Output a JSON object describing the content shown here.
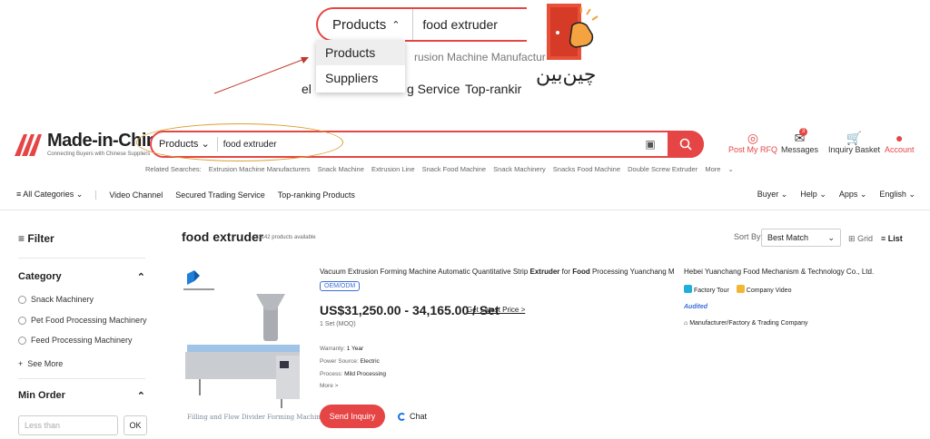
{
  "zoom": {
    "select_label": "Products",
    "query": "food extruder",
    "dropdown": [
      "Products",
      "Suppliers"
    ],
    "bg_text_1": "rusion Machine Manufactur",
    "bg_text_2a": "el",
    "bg_text_2b": "g Service",
    "bg_text_2c": "Top-rankir"
  },
  "brand_text": "چین‌بین",
  "site": {
    "name": "Made-in-China",
    "tagline": "Connecting Buyers with Chinese Suppliers"
  },
  "search": {
    "select_label": "Products",
    "query": "food extruder"
  },
  "header_actions": [
    {
      "icon": "target-icon",
      "label": "Post My RFQ"
    },
    {
      "icon": "messages-icon",
      "label": "Messages",
      "badge": "3"
    },
    {
      "icon": "basket-icon",
      "label": "Inquiry Basket"
    },
    {
      "icon": "account-icon",
      "label": "Account"
    }
  ],
  "related": {
    "label": "Related Searches:",
    "items": [
      "Extrusion Machine Manufacturers",
      "Snack Machine",
      "Extrusion Line",
      "Snack Food Machine",
      "Snack Machinery",
      "Snacks Food Machine",
      "Double Screw Extruder",
      "More"
    ]
  },
  "nav": {
    "all_categories": "All Categories",
    "items": [
      "Video Channel",
      "Secured Trading Service",
      "Top-ranking Products"
    ],
    "right": [
      "Buyer",
      "Help",
      "Apps",
      "English"
    ]
  },
  "filter": {
    "title": "Filter",
    "category_title": "Category",
    "categories": [
      "Snack Machinery",
      "Pet Food Processing Machinery",
      "Feed Processing Machinery"
    ],
    "see_more": "See More",
    "min_order_title": "Min Order",
    "min_order_placeholder": "Less than",
    "ok": "OK"
  },
  "results": {
    "query": "food extruder",
    "count": "121142 products available",
    "sort_label": "Sort By:",
    "sort_value": "Best Match",
    "grid": "Grid",
    "list": "List"
  },
  "product": {
    "title_a": "Vacuum Extrusion Forming Machine Automatic Quantitative Strip ",
    "title_b": "Extruder",
    "title_c": " for ",
    "title_d": "Food",
    "title_e": " Processing Yuanchang M...",
    "tag": "OEM/ODM",
    "price": "US$31,250.00 - 34,165.00 / Set",
    "latest_price": "Get Latest Price >",
    "moq": "1 Set (MOQ)",
    "specs": [
      {
        "k": "Warranty:",
        "v": "1 Year"
      },
      {
        "k": "Power Source:",
        "v": "Electric"
      },
      {
        "k": "Process:",
        "v": "Mild Processing"
      }
    ],
    "more": "More >",
    "image_caption": "Filling and Flow Divider Forming Machine",
    "inquiry": "Send Inquiry",
    "chat": "Chat",
    "company": "Hebei Yuanchang Food Mechanism & Technology Co., Ltd.",
    "factory_tour": "Factory Tour",
    "company_video": "Company Video",
    "audited": "Audited",
    "type": "Manufacturer/Factory & Trading Company"
  },
  "colors": {
    "accent": "#e64545",
    "link_blue": "#3a6fd8",
    "annotation": "#d9a030"
  }
}
